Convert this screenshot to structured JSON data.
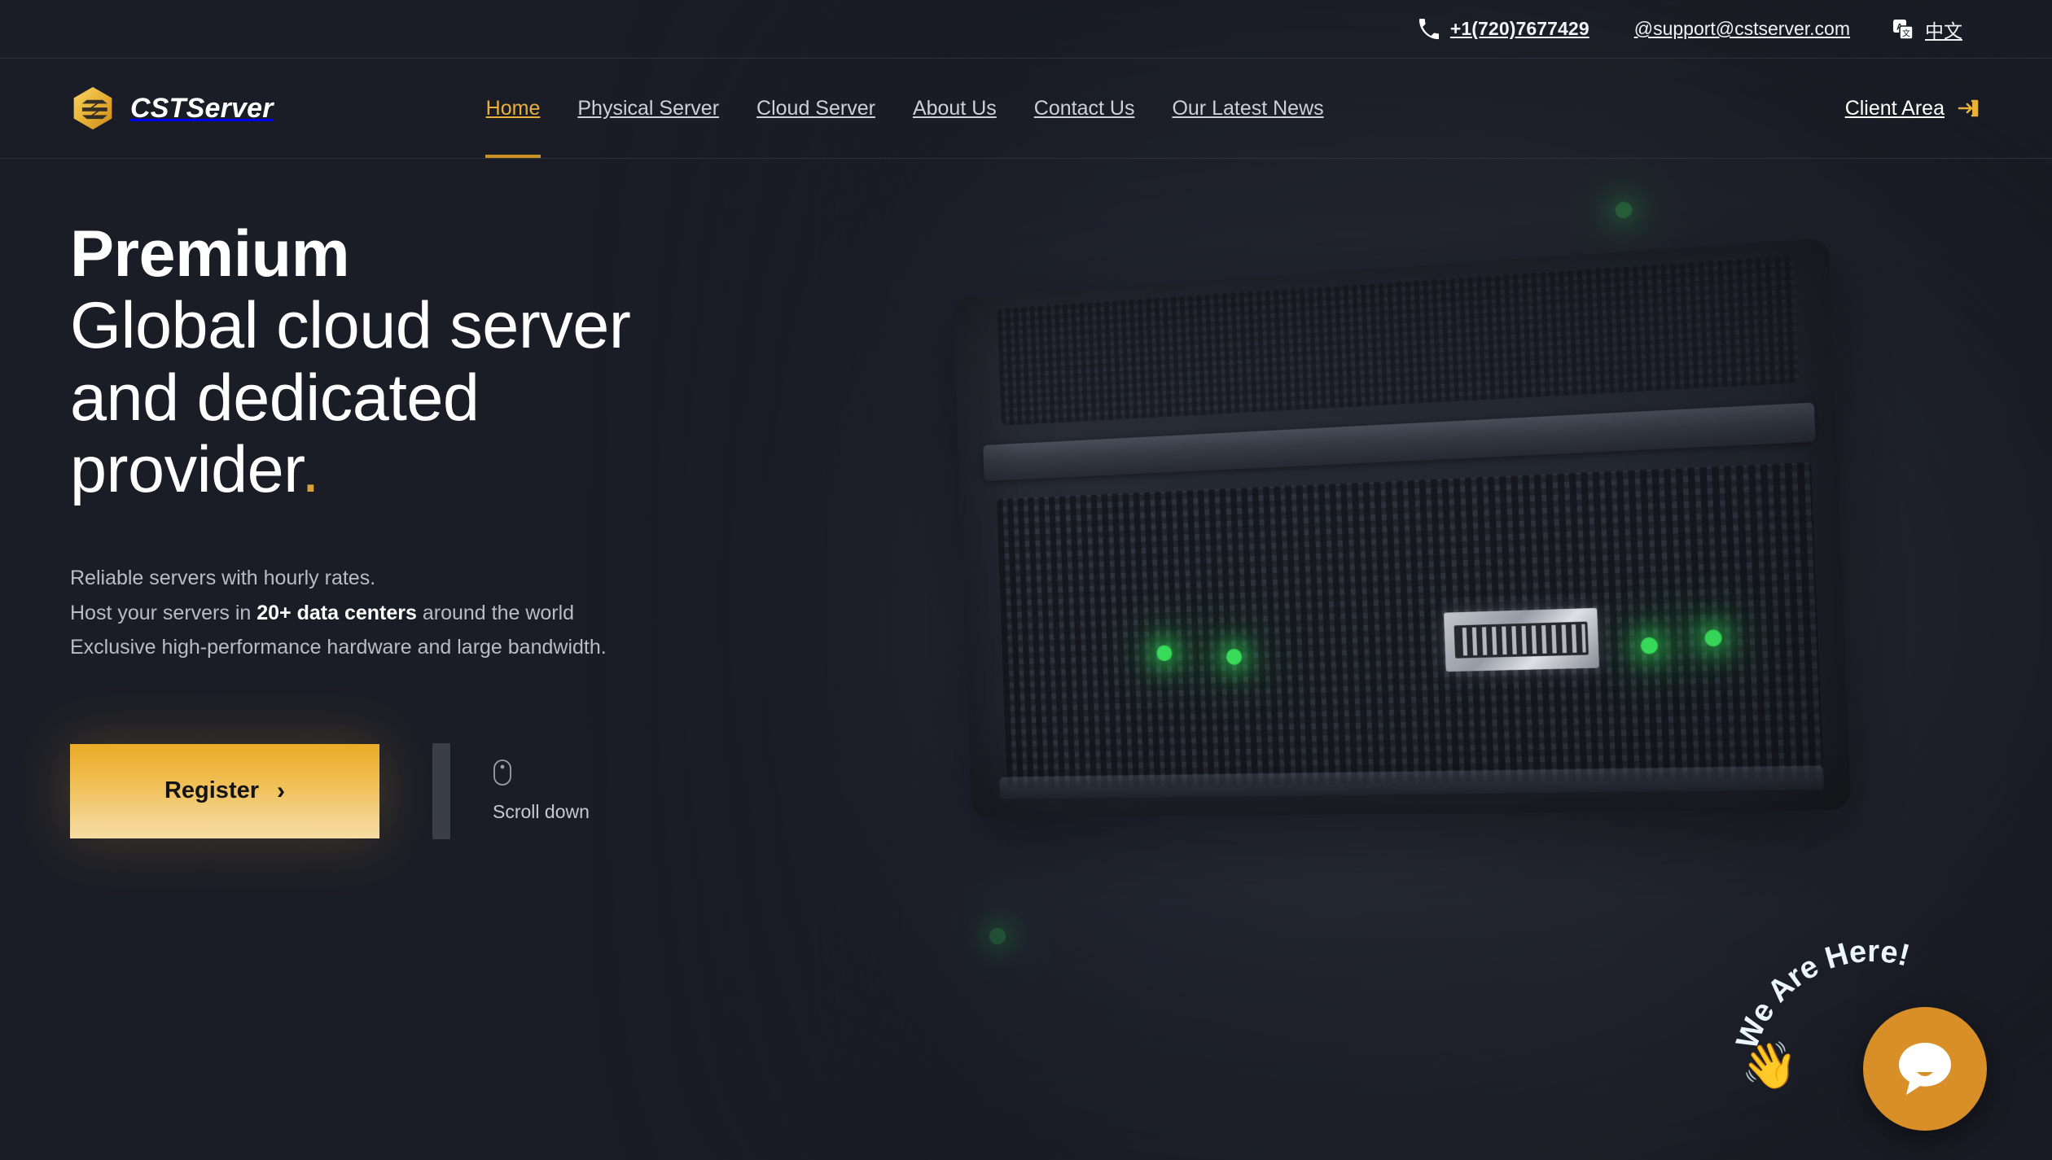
{
  "topbar": {
    "phone": "+1(720)7677429",
    "phone_icon": "phone-icon",
    "email": "@support@cstserver.com",
    "language": "中文",
    "language_icon": "translate-icon"
  },
  "brand": {
    "name": "CSTServer",
    "logo_icon": "hexagon-layers-logo-icon",
    "logo_color": "#e8b13c"
  },
  "nav": {
    "items": [
      {
        "label": "Home",
        "active": true
      },
      {
        "label": "Physical Server",
        "active": false
      },
      {
        "label": "Cloud Server",
        "active": false
      },
      {
        "label": "About Us",
        "active": false
      },
      {
        "label": "Contact Us",
        "active": false
      },
      {
        "label": "Our Latest News",
        "active": false
      }
    ],
    "active_color": "#e8b13c",
    "inactive_color": "#cdd0d6",
    "client_area_label": "Client Area",
    "client_area_icon": "login-arrow-icon"
  },
  "hero": {
    "headline_line1": "Premium",
    "headline_line2": "Global cloud server",
    "headline_line3": "and dedicated",
    "headline_line4": "provider",
    "headline_dot": ".",
    "sub_line1": "Reliable servers with hourly rates.",
    "sub_line2_pre": "Host your servers in ",
    "sub_line2_strong": "20+ data centers",
    "sub_line2_post": " around the world",
    "sub_line3": "Exclusive high-performance hardware and large bandwidth.",
    "cta_label": "Register",
    "cta_chevron": "›",
    "scroll_label": "Scroll down",
    "scroll_icon": "mouse-icon",
    "accent_color": "#e8b13c"
  },
  "chat": {
    "prompt": "We Are Here!",
    "hand_icon": "waving-hand-icon",
    "bubble_icon": "chat-bubble-icon",
    "bubble_color": "#d88f28"
  }
}
